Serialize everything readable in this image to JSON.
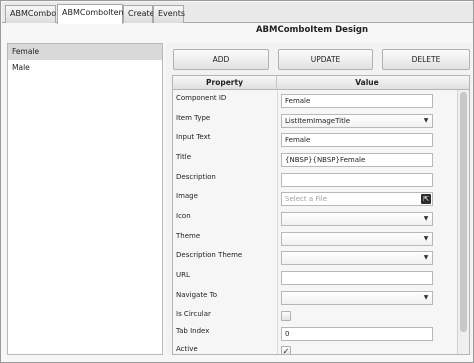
{
  "tabs": [
    {
      "label": "ABMCombo"
    },
    {
      "label": "ABMComboItem"
    },
    {
      "label": "Create"
    },
    {
      "label": "Events"
    }
  ],
  "design_title": "ABMComboItem Design",
  "list": {
    "items": [
      {
        "label": "Female",
        "selected": true
      },
      {
        "label": "Male",
        "selected": false
      }
    ]
  },
  "buttons": {
    "add": "ADD",
    "update": "UPDATE",
    "delete": "DELETE"
  },
  "table": {
    "headers": {
      "property": "Property",
      "value": "Value"
    },
    "rows": [
      {
        "label": "Component ID",
        "type": "text",
        "value": "Female"
      },
      {
        "label": "Item Type",
        "type": "select",
        "value": "ListItemImageTitle"
      },
      {
        "label": "Input Text",
        "type": "text",
        "value": "Female"
      },
      {
        "label": "Title",
        "type": "text",
        "value": "{NBSP}{NBSP}Female"
      },
      {
        "label": "Description",
        "type": "text",
        "value": ""
      },
      {
        "label": "Image",
        "type": "file",
        "placeholder": "Select a File"
      },
      {
        "label": "Icon",
        "type": "select",
        "value": ""
      },
      {
        "label": "Theme",
        "type": "select",
        "value": ""
      },
      {
        "label": "Description Theme",
        "type": "select",
        "value": ""
      },
      {
        "label": "URL",
        "type": "text",
        "value": ""
      },
      {
        "label": "Navigate To",
        "type": "select",
        "value": ""
      },
      {
        "label": "Is Circular",
        "type": "checkbox",
        "checked": false
      },
      {
        "label": "Tab Index",
        "type": "text",
        "value": "0"
      },
      {
        "label": "Active",
        "type": "checkbox",
        "checked": true
      }
    ]
  }
}
